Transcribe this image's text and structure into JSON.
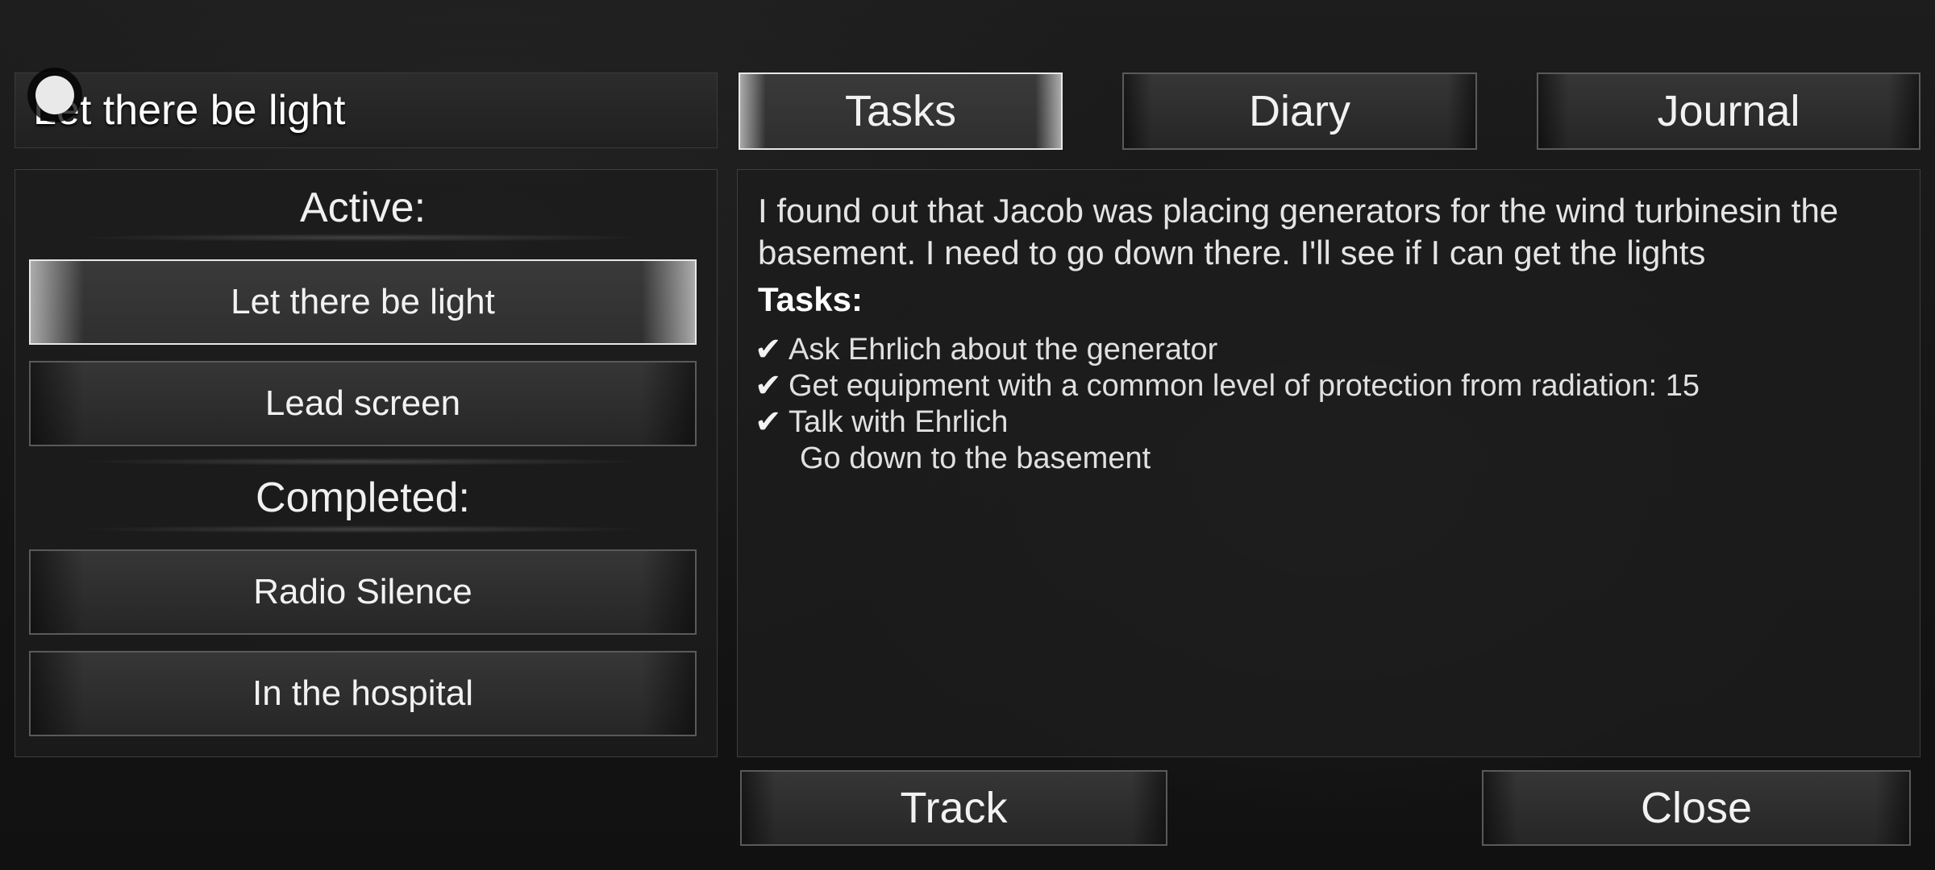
{
  "header": {
    "title": "Let there be light"
  },
  "tabs": [
    {
      "label": "Tasks",
      "selected": true
    },
    {
      "label": "Diary",
      "selected": false
    },
    {
      "label": "Journal",
      "selected": false
    }
  ],
  "quests": {
    "active_label": "Active:",
    "active": [
      {
        "label": "Let there be light",
        "selected": true
      },
      {
        "label": "Lead screen",
        "selected": false
      }
    ],
    "completed_label": "Completed:",
    "completed": [
      {
        "label": "Radio Silence"
      },
      {
        "label": "In the hospital"
      }
    ]
  },
  "details": {
    "description": "I found out that Jacob was placing generators for the wind turbinesin the basement. I need to go down there. I'll see if I can get the lights",
    "tasks_heading": "Tasks:",
    "check_glyph": "✔",
    "tasks": [
      {
        "text": "Ask Ehrlich about the generator",
        "done": true
      },
      {
        "text": "Get equipment with a common level of protection from radiation: 15",
        "done": true
      },
      {
        "text": "Talk with Ehrlich",
        "done": true
      },
      {
        "text": "Go down to the basement",
        "done": false
      }
    ]
  },
  "footer": {
    "track_label": "Track",
    "close_label": "Close"
  },
  "colors": {
    "selected_border": "#e8e8e8",
    "button_border": "#5a5a5a",
    "text": "#e6e6e6"
  }
}
